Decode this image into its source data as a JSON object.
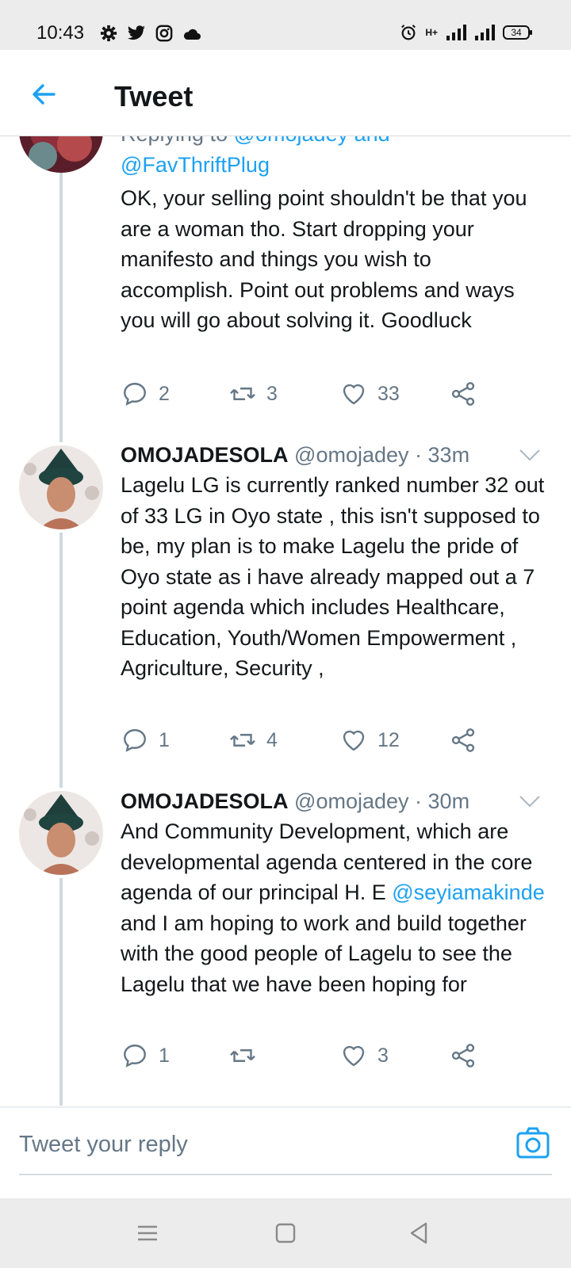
{
  "status_bar": {
    "time": "10:43",
    "left_icons": [
      "gear-icon",
      "twitter-icon",
      "instagram-icon",
      "cloud-icon"
    ],
    "right_icons": [
      "alarm-icon",
      "mobile-data-icon",
      "signal-icon",
      "battery-icon"
    ],
    "battery": "34",
    "network_label": "H+"
  },
  "header": {
    "title": "Tweet",
    "accent_color": "#1da1f2"
  },
  "tweets": [
    {
      "reply_label": "Replying to",
      "reply_mentions": "@omojadey and",
      "reply_mention_2": "@FavThriftPlug",
      "text": "OK, your selling point shouldn't be that you are a woman tho. Start dropping your manifesto and things you wish to accomplish. Point out problems and ways you will go about solving it. Goodluck",
      "replies": "2",
      "retweets": "3",
      "likes": "33"
    },
    {
      "name": "OMOJADESOLA",
      "handle": "@omojadey",
      "time": "· 33m",
      "text": "Lagelu LG is currently ranked number 32 out of 33 LG in Oyo state , this isn't supposed to be, my plan is to make Lagelu the pride of Oyo state as i have already mapped out a 7 point agenda which includes Healthcare, Education, Youth/Women Empowerment , Agriculture, Security ,",
      "replies": "1",
      "retweets": "4",
      "likes": "12"
    },
    {
      "name": "OMOJADESOLA",
      "handle": "@omojadey",
      "time": "· 30m",
      "text_before": "And Community Development, which are developmental agenda centered in the core agenda of our principal H. E",
      "mention": "@seyiamakinde",
      "text_after": "and I am hoping to work and build together with the good people of Lagelu to see the Lagelu that we have been hoping for",
      "replies": "1",
      "retweets": "",
      "likes": "3"
    }
  ],
  "reply_bar": {
    "placeholder": "Tweet your reply"
  }
}
